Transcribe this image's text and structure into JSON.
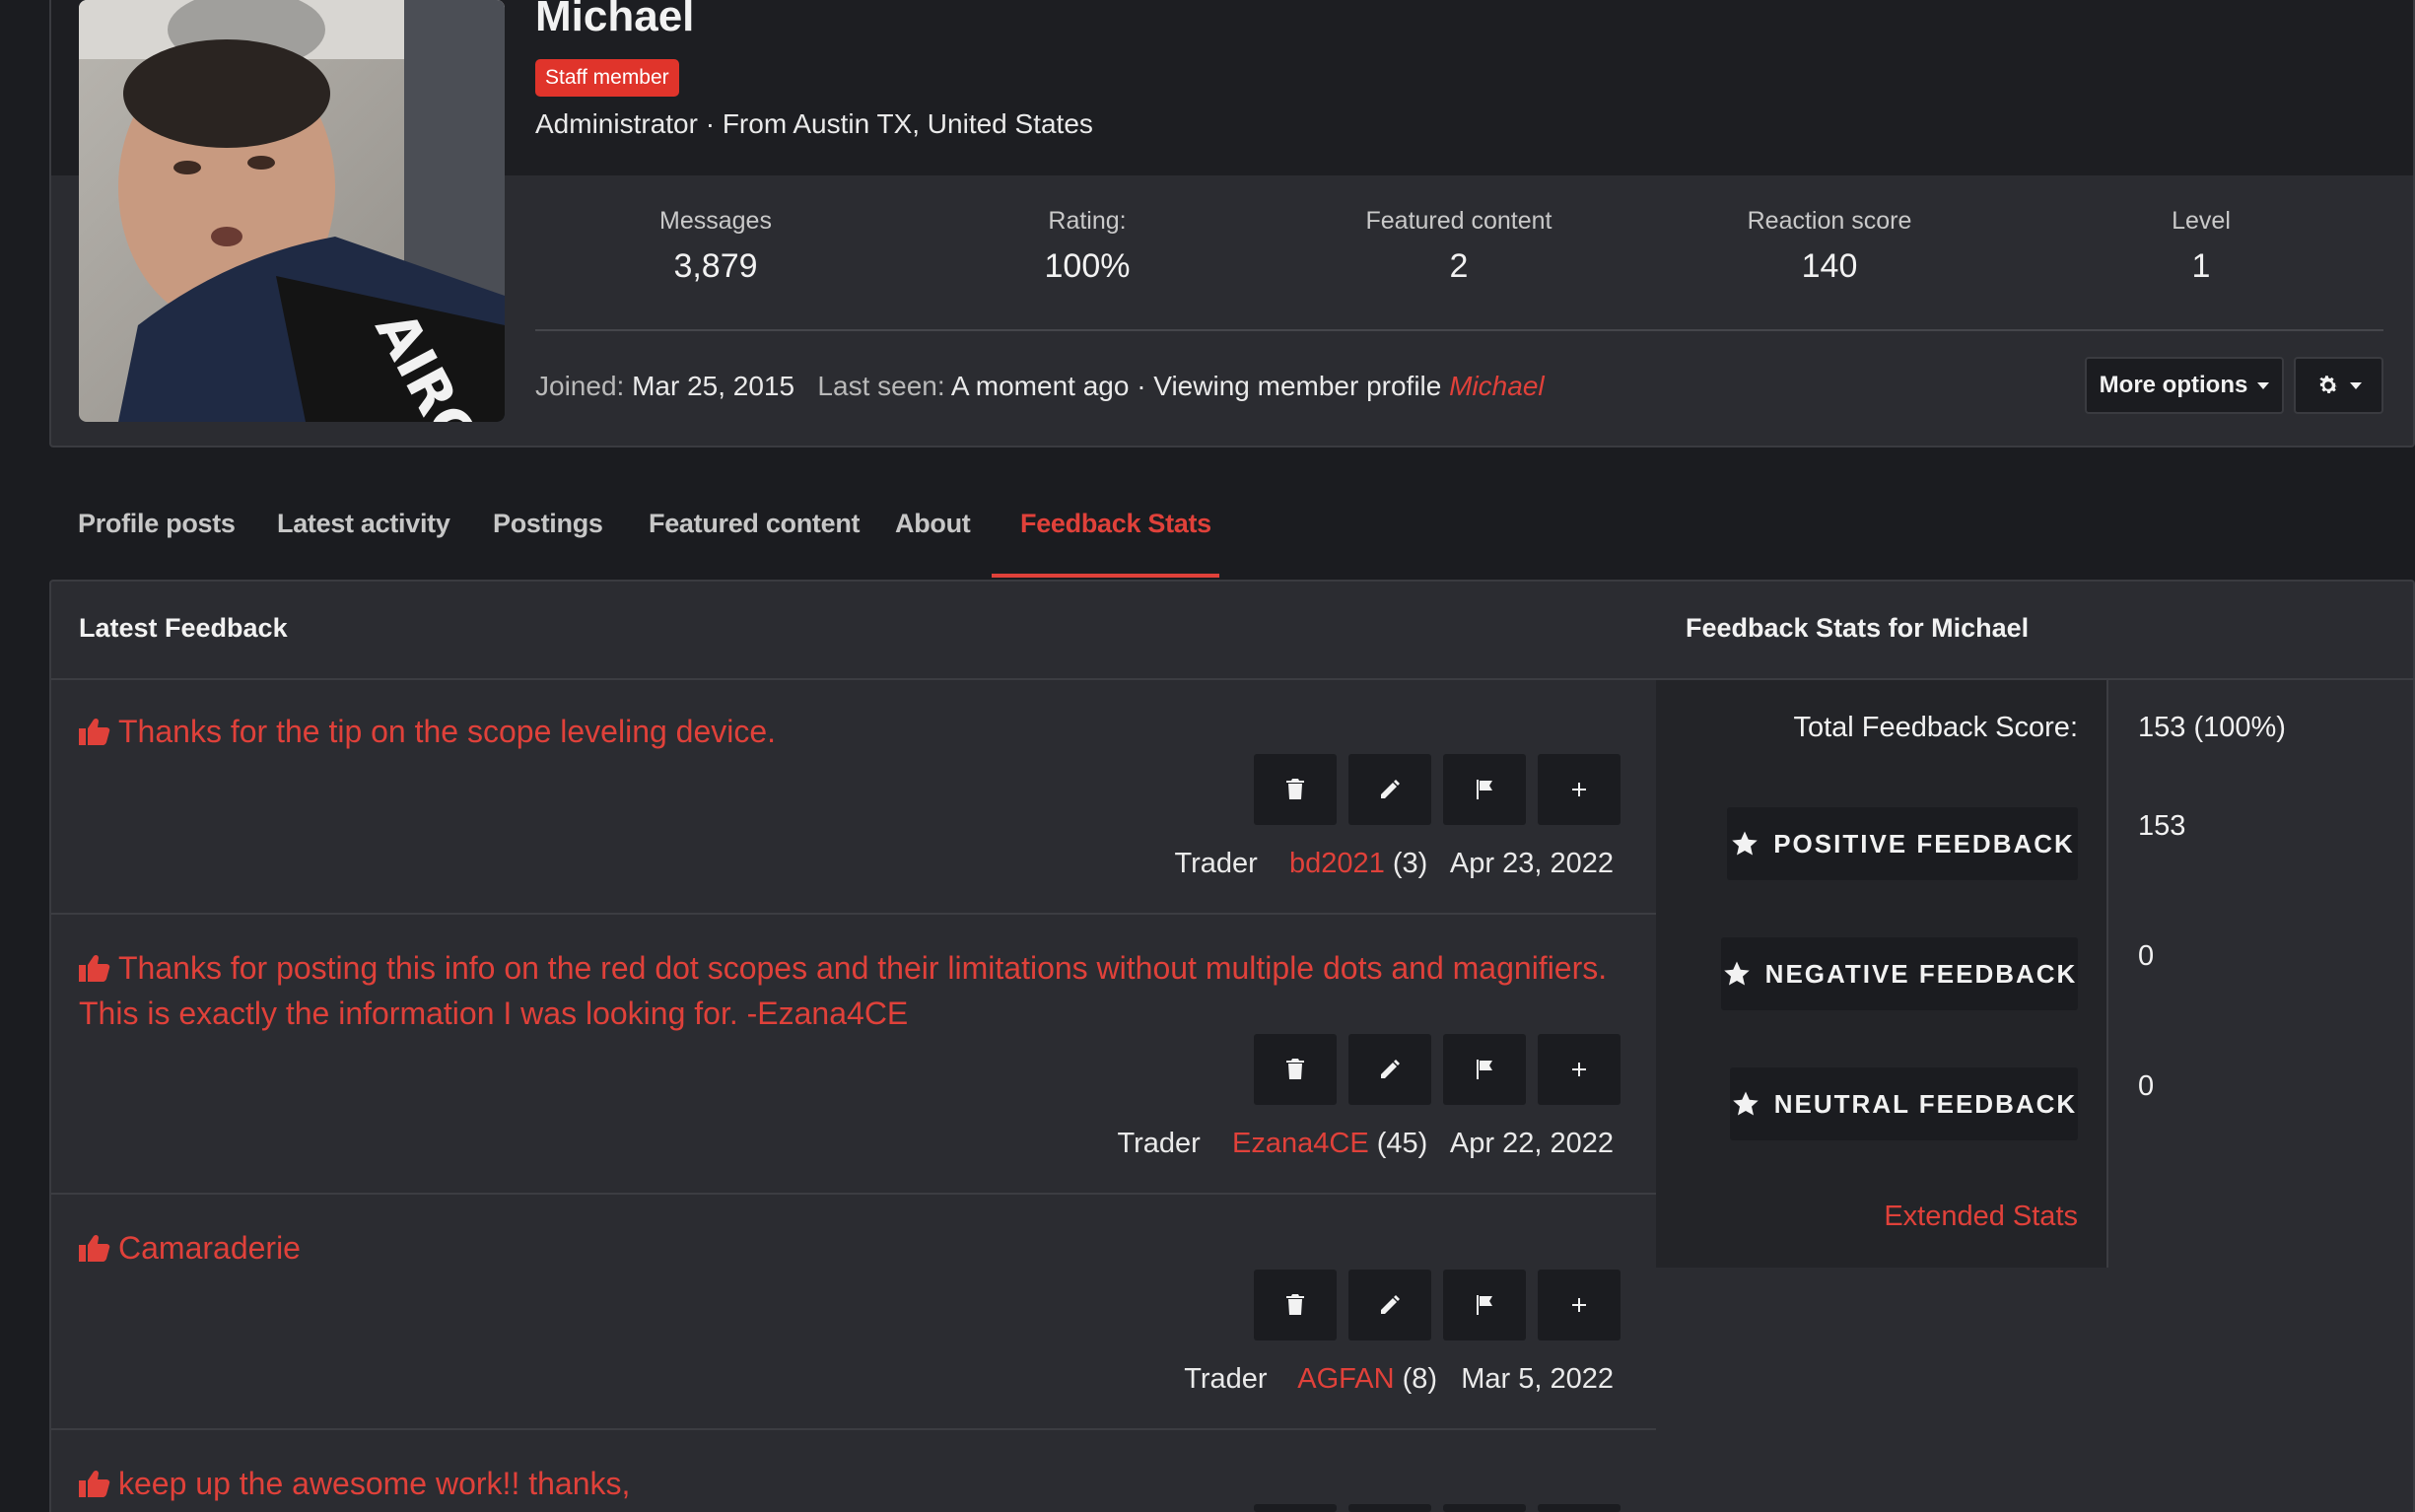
{
  "profile": {
    "username": "Michael",
    "badge": "Staff member",
    "blurb": "Administrator · From Austin TX, United States",
    "stats": [
      {
        "label": "Messages",
        "value": "3,879"
      },
      {
        "label": "Rating:",
        "value": "100%"
      },
      {
        "label": "Featured content",
        "value": "2"
      },
      {
        "label": "Reaction score",
        "value": "140"
      },
      {
        "label": "Level",
        "value": "1"
      }
    ],
    "joined_label": "Joined:",
    "joined_value": "Mar 25, 2015",
    "last_seen_label": "Last seen:",
    "last_seen_value": "A moment ago · Viewing member profile",
    "last_seen_link": "Michael",
    "more_options_label": "More options",
    "avatar_text": "AIRGUN NATION"
  },
  "tabs": [
    {
      "label": "Profile posts"
    },
    {
      "label": "Latest activity"
    },
    {
      "label": "Postings"
    },
    {
      "label": "Featured content"
    },
    {
      "label": "About"
    },
    {
      "label": "Feedback Stats",
      "active": true
    }
  ],
  "latest_feedback": {
    "title": "Latest Feedback",
    "trader_label": "Trader",
    "items": [
      {
        "text": "Thanks for the tip on the scope leveling device.",
        "user": "bd2021",
        "count": "(3)",
        "date": "Apr 23, 2022"
      },
      {
        "text": "Thanks for posting this info on the red dot scopes and their limitations without multiple dots and magnifiers. This is exactly the information I was looking for. -Ezana4CE",
        "user": "Ezana4CE",
        "count": "(45)",
        "date": "Apr 22, 2022"
      },
      {
        "text": "Camaraderie",
        "user": "AGFAN",
        "count": "(8)",
        "date": "Mar 5, 2022"
      },
      {
        "text": "keep up the awesome work!! thanks,"
      }
    ]
  },
  "feedback_stats": {
    "title": "Feedback Stats for Michael",
    "total_label": "Total Feedback Score:",
    "total_value": "153 (100%)",
    "positive_label": "POSITIVE FEEDBACK",
    "positive_value": "153",
    "negative_label": "NEGATIVE FEEDBACK",
    "negative_value": "0",
    "neutral_label": "NEUTRAL FEEDBACK",
    "neutral_value": "0",
    "extended_label": "Extended Stats"
  },
  "colors": {
    "accent": "#e0413a",
    "background": "#1b1c20",
    "panel": "#2b2c31"
  }
}
